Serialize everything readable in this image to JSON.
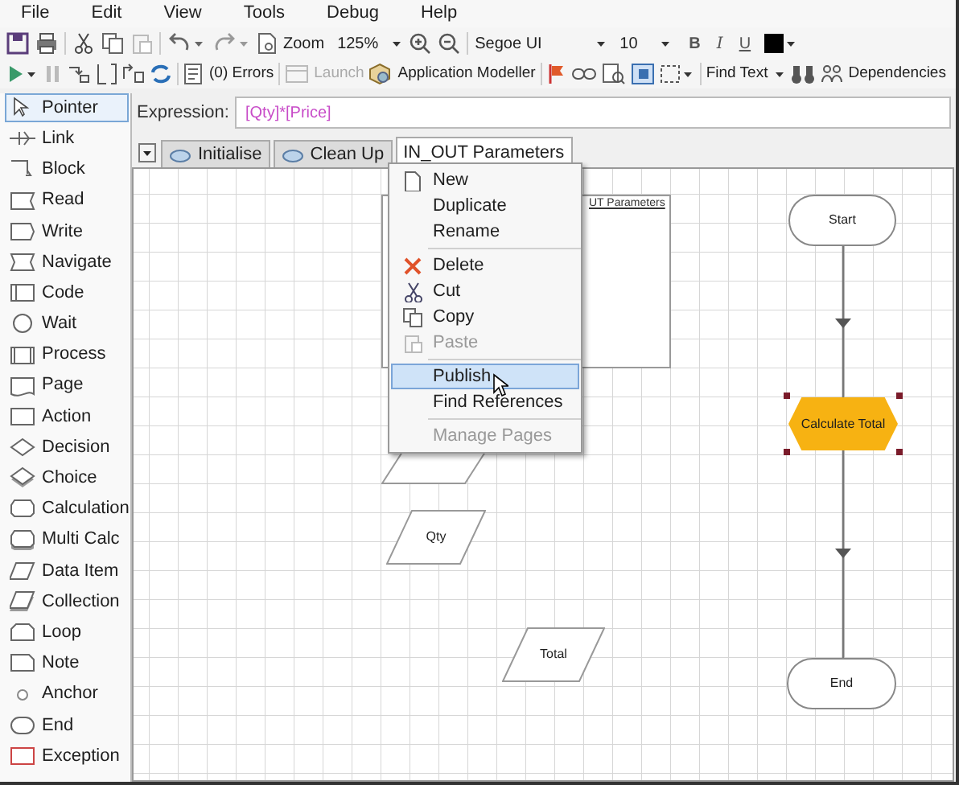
{
  "menu_bar": [
    "File",
    "Edit",
    "View",
    "Tools",
    "Debug",
    "Help"
  ],
  "toolbar": {
    "zoom_label": "Zoom",
    "zoom_value": "125%",
    "font": "Segoe UI",
    "font_size": "10",
    "bold": "B",
    "italic": "I",
    "underline": "U"
  },
  "debug_toolbar": {
    "errors": "(0) Errors",
    "launch": {
      "label": "Launch",
      "disabled": true
    },
    "app_modeller": "Application Modeller",
    "find_text": "Find Text",
    "dependencies": "Dependencies"
  },
  "palette": [
    {
      "label": "Pointer",
      "selected": true
    },
    {
      "label": "Link",
      "selected": false
    },
    {
      "label": "Block",
      "selected": false
    },
    {
      "label": "Read",
      "selected": false
    },
    {
      "label": "Write",
      "selected": false
    },
    {
      "label": "Navigate",
      "selected": false
    },
    {
      "label": "Code",
      "selected": false
    },
    {
      "label": "Wait",
      "selected": false
    },
    {
      "label": "Process",
      "selected": false
    },
    {
      "label": "Page",
      "selected": false
    },
    {
      "label": "Action",
      "selected": false
    },
    {
      "label": "Decision",
      "selected": false
    },
    {
      "label": "Choice",
      "selected": false
    },
    {
      "label": "Calculation",
      "selected": false
    },
    {
      "label": "Multi Calc",
      "selected": false
    },
    {
      "label": "Data Item",
      "selected": false
    },
    {
      "label": "Collection",
      "selected": false
    },
    {
      "label": "Loop",
      "selected": false
    },
    {
      "label": "Note",
      "selected": false
    },
    {
      "label": "Anchor",
      "selected": false
    },
    {
      "label": "End",
      "selected": false
    },
    {
      "label": "Exception",
      "selected": false
    }
  ],
  "expression": {
    "label": "Expression:",
    "value": "[Qty]*[Price]"
  },
  "page_tabs": [
    {
      "label": "Initialise",
      "selected": false
    },
    {
      "label": "Clean Up",
      "selected": false
    },
    {
      "label": "IN_OUT Parameters",
      "selected": true
    }
  ],
  "canvas": {
    "parameters_panel": {
      "title": "UT Parameters"
    },
    "nodes": [
      {
        "kind": "terminal",
        "label": "Start",
        "selected": false
      },
      {
        "kind": "process",
        "label": "Calculate Total",
        "selected": true
      },
      {
        "kind": "terminal",
        "label": "End",
        "selected": false
      },
      {
        "kind": "data",
        "label": "Qty",
        "selected": false
      },
      {
        "kind": "data",
        "label": "Total",
        "selected": false
      }
    ]
  },
  "context_menu": [
    {
      "label": "New",
      "disabled": false,
      "selected": false,
      "separator_before": false
    },
    {
      "label": "Duplicate",
      "disabled": false,
      "selected": false,
      "separator_before": false
    },
    {
      "label": "Rename",
      "disabled": false,
      "selected": false,
      "separator_before": false
    },
    {
      "label": "Delete",
      "disabled": false,
      "selected": false,
      "separator_before": true
    },
    {
      "label": "Cut",
      "disabled": false,
      "selected": false,
      "separator_before": false
    },
    {
      "label": "Copy",
      "disabled": false,
      "selected": false,
      "separator_before": false
    },
    {
      "label": "Paste",
      "disabled": true,
      "selected": false,
      "separator_before": false
    },
    {
      "label": "Publish",
      "disabled": false,
      "selected": true,
      "separator_before": true
    },
    {
      "label": "Find References",
      "disabled": false,
      "selected": false,
      "separator_before": false
    },
    {
      "label": "Manage Pages",
      "disabled": true,
      "selected": false,
      "separator_before": true
    }
  ]
}
